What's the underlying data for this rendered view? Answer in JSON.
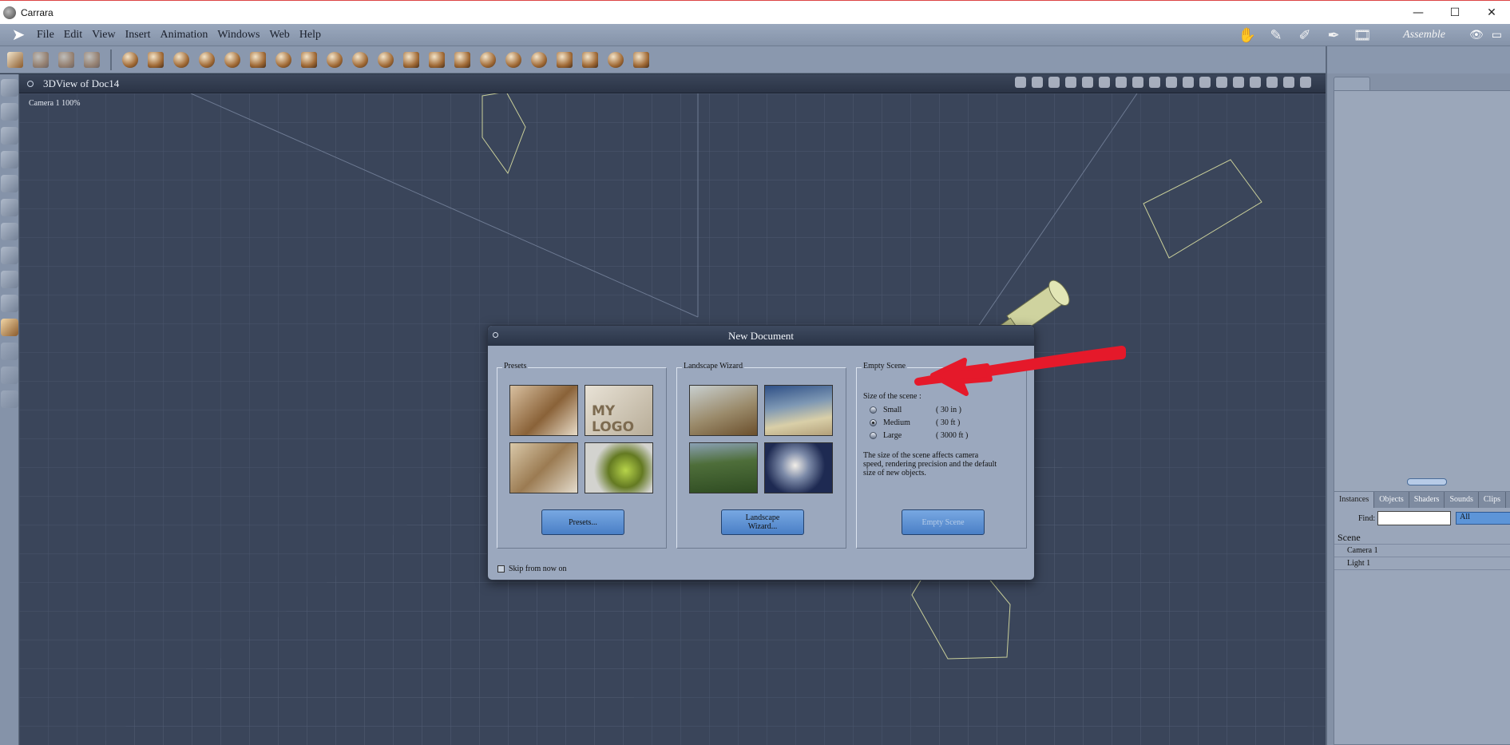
{
  "window": {
    "title": "Carrara",
    "controls": {
      "minimize": "—",
      "maximize": "☐",
      "close": "✕"
    }
  },
  "menu": {
    "items": [
      "File",
      "Edit",
      "View",
      "Insert",
      "Animation",
      "Windows",
      "Web",
      "Help"
    ],
    "room_label": "Assemble"
  },
  "view": {
    "title": "3DView of Doc14",
    "camera_label": "Camera 1 100%"
  },
  "dialog": {
    "title": "New Document",
    "presets": {
      "label": "Presets",
      "button": "Presets..."
    },
    "landscape": {
      "label": "Landscape Wizard",
      "button_line1": "Landscape",
      "button_line2": "Wizard..."
    },
    "empty_scene": {
      "label": "Empty Scene",
      "size_title": "Size of the scene :",
      "options": [
        {
          "name": "Small",
          "size": "( 30 in )",
          "selected": false
        },
        {
          "name": "Medium",
          "size": "( 30 ft )",
          "selected": true
        },
        {
          "name": "Large",
          "size": "( 3000 ft )",
          "selected": false
        }
      ],
      "description": "The size of the scene affects camera speed, rendering precision and the default size of new objects.",
      "button": "Empty Scene"
    },
    "skip_label": "Skip from now on"
  },
  "right_panel": {
    "tabs": [
      "Instances",
      "Objects",
      "Shaders",
      "Sounds",
      "Clips"
    ],
    "active_tab": "Instances",
    "find_label": "Find:",
    "find_value": "",
    "filter_value": "All",
    "scene_header": "Scene",
    "scene_items": [
      "Camera 1",
      "Light 1"
    ]
  },
  "colors": {
    "accent_button": "#5d95d8",
    "annotation_red": "#e5192a",
    "dialog_bg": "#9ba8be"
  }
}
